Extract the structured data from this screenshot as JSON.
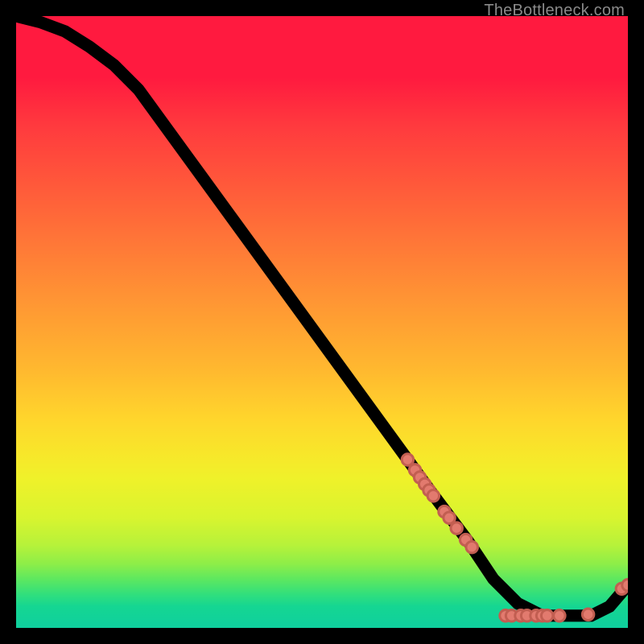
{
  "attribution": "TheBottleneck.com",
  "colors": {
    "page_bg": "#000000",
    "marker_fill": "#e27a6e",
    "marker_stroke": "#c25e51",
    "curve": "#000000",
    "gradient_top": "#ff1a3f",
    "gradient_mid": "#ffd62c",
    "gradient_bottom": "#0fcf9e"
  },
  "chart_data": {
    "type": "line",
    "title": "",
    "xlabel": "",
    "ylabel": "",
    "xlim": [
      0,
      100
    ],
    "ylim": [
      0,
      100
    ],
    "grid": false,
    "legend": null,
    "series": [
      {
        "name": "curve",
        "x": [
          0,
          4,
          8,
          12,
          16,
          20,
          28,
          36,
          44,
          52,
          60,
          68,
          74,
          78,
          82,
          86,
          90,
          94,
          97,
          100
        ],
        "y": [
          100,
          99,
          97.5,
          95,
          92,
          88,
          77,
          66,
          55,
          44,
          33,
          22,
          14,
          8,
          4,
          2,
          2,
          2,
          3.5,
          7
        ]
      }
    ],
    "markers": [
      {
        "x": 64.0,
        "y": 27.5
      },
      {
        "x": 65.2,
        "y": 25.8
      },
      {
        "x": 66.0,
        "y": 24.6
      },
      {
        "x": 66.8,
        "y": 23.5
      },
      {
        "x": 67.5,
        "y": 22.5
      },
      {
        "x": 68.2,
        "y": 21.6
      },
      {
        "x": 70.0,
        "y": 19.0
      },
      {
        "x": 70.8,
        "y": 18.0
      },
      {
        "x": 72.0,
        "y": 16.3
      },
      {
        "x": 73.5,
        "y": 14.4
      },
      {
        "x": 74.5,
        "y": 13.2
      },
      {
        "x": 80.0,
        "y": 2.0
      },
      {
        "x": 81.0,
        "y": 2.0
      },
      {
        "x": 82.5,
        "y": 2.0
      },
      {
        "x": 83.5,
        "y": 2.0
      },
      {
        "x": 85.0,
        "y": 2.0
      },
      {
        "x": 86.0,
        "y": 2.0
      },
      {
        "x": 86.8,
        "y": 2.0
      },
      {
        "x": 88.8,
        "y": 2.0
      },
      {
        "x": 93.5,
        "y": 2.2
      },
      {
        "x": 99.0,
        "y": 6.4
      },
      {
        "x": 100.0,
        "y": 7.0
      }
    ]
  }
}
